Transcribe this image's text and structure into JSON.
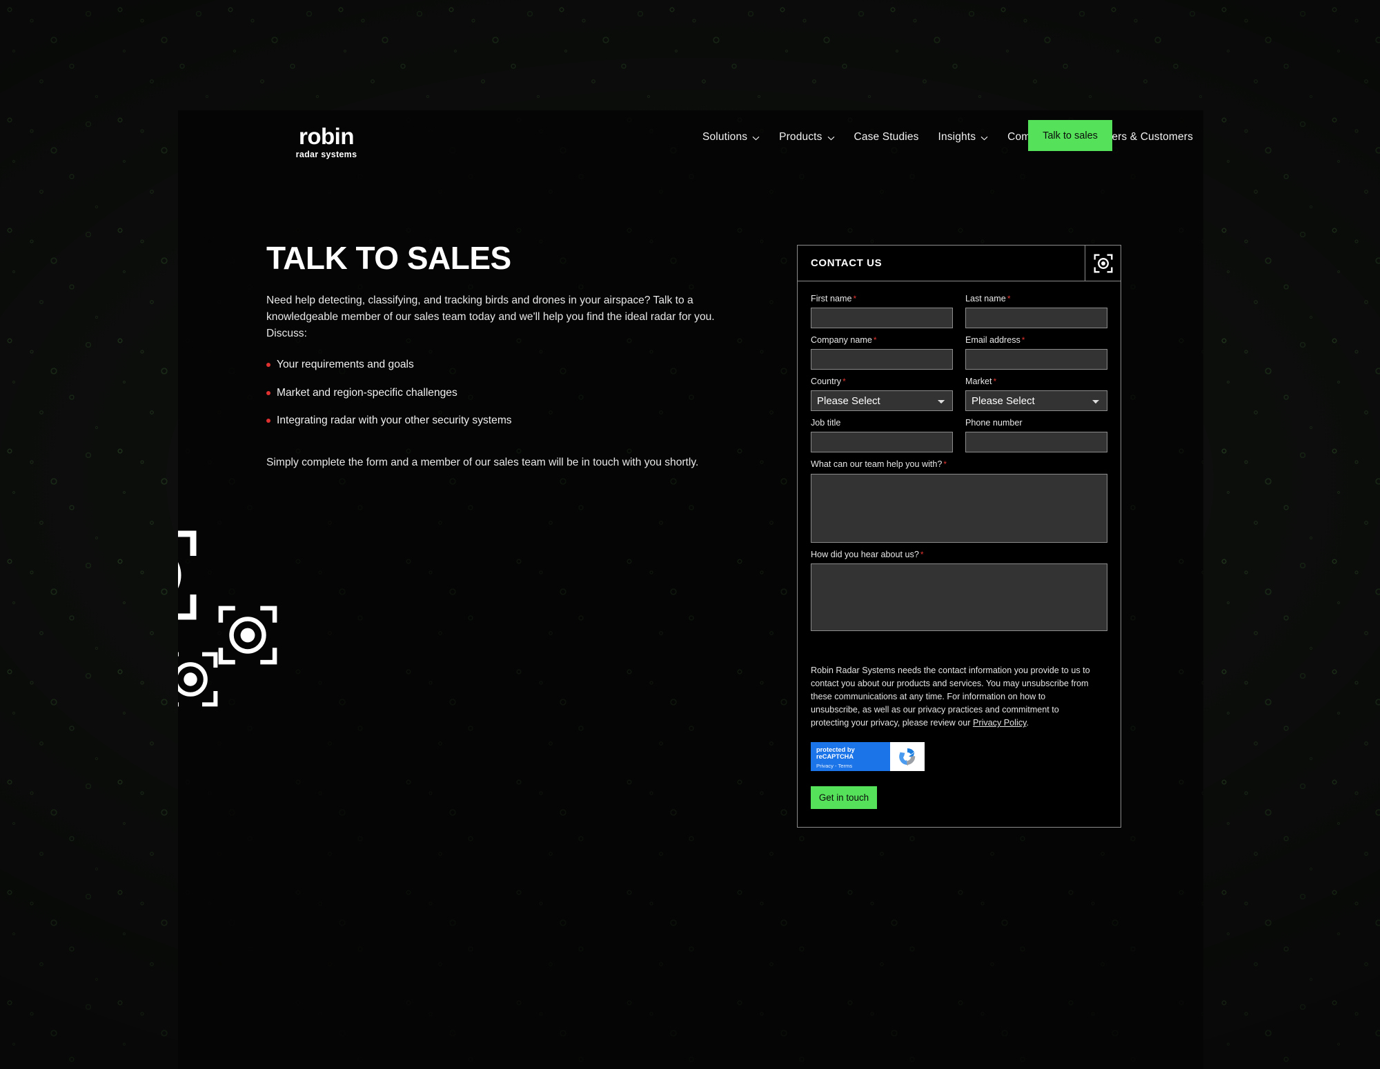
{
  "brand": {
    "logo_word": "robin",
    "logo_sub": "radar systems"
  },
  "nav": {
    "items": [
      {
        "label": "Solutions",
        "has_caret": true
      },
      {
        "label": "Products",
        "has_caret": true
      },
      {
        "label": "Case Studies",
        "has_caret": false
      },
      {
        "label": "Insights",
        "has_caret": true
      },
      {
        "label": "Company",
        "has_caret": true
      },
      {
        "label": "Partners & Customers",
        "has_caret": false
      }
    ],
    "cta_label": "Talk to sales"
  },
  "hero": {
    "title": "TALK TO SALES",
    "intro": "Need help detecting, classifying, and tracking birds and drones in your airspace? Talk to a knowledgeable member of our sales team today and we'll help you find the ideal radar for you. Discuss:",
    "bullets": [
      "Your requirements and goals",
      "Market and region-specific challenges",
      "Integrating radar with your other security systems"
    ],
    "outro": "Simply complete the form and a member of our sales team will be in touch with you shortly."
  },
  "form": {
    "heading": "CONTACT US",
    "header_icon": "radar-target-icon",
    "fields": {
      "first_name": {
        "label": "First name",
        "required": true,
        "value": ""
      },
      "last_name": {
        "label": "Last name",
        "required": true,
        "value": ""
      },
      "company_name": {
        "label": "Company name",
        "required": true,
        "value": ""
      },
      "email": {
        "label": "Email address",
        "required": true,
        "value": ""
      },
      "country": {
        "label": "Country",
        "required": true,
        "value": "Please Select",
        "options": [
          "Please Select"
        ]
      },
      "market": {
        "label": "Market",
        "required": true,
        "value": "Please Select",
        "options": [
          "Please Select"
        ]
      },
      "job_title": {
        "label": "Job title",
        "required": false,
        "value": ""
      },
      "phone": {
        "label": "Phone number",
        "required": false,
        "value": ""
      },
      "help_with": {
        "label": "What can our team help you with?",
        "required": true,
        "value": ""
      },
      "hear_about": {
        "label": "How did you hear about us?",
        "required": true,
        "value": ""
      }
    },
    "privacy_text": "Robin Radar Systems needs the contact information you provide to us to contact you about our products and services. You may unsubscribe from these communications at any time. For information on how to unsubscribe, as well as our privacy practices and commitment to protecting your privacy, please review our ",
    "privacy_link": "Privacy Policy",
    "privacy_period": ".",
    "recaptcha": {
      "title": "protected by reCAPTCHA",
      "subtitle": "Privacy - Terms"
    },
    "submit_label": "Get in touch"
  },
  "colors": {
    "accent_green": "#55e25a",
    "required_red": "#e0342f",
    "bullet_red": "#e03131",
    "panel_black": "#050505",
    "input_fill": "#333333",
    "input_border": "#8d8d8d",
    "recaptcha_blue": "#1b74e8"
  },
  "decor": {
    "radar_markers": [
      "radar-target-icon",
      "radar-target-icon",
      "radar-target-icon"
    ]
  }
}
